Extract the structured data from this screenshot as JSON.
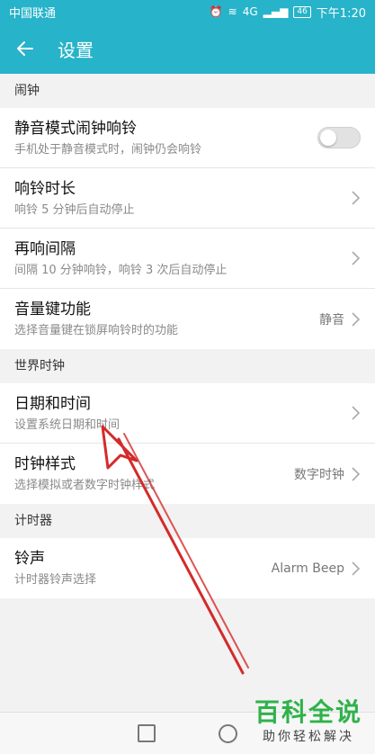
{
  "status_bar": {
    "carrier": "中国联通",
    "network": "4G",
    "battery": "46",
    "time": "下午1:20"
  },
  "app_bar": {
    "title": "设置"
  },
  "sections": {
    "alarm": {
      "header": "闹钟",
      "items": [
        {
          "title": "静音模式闹钟响铃",
          "subtitle": "手机处于静音模式时，闹钟仍会响铃",
          "toggle": false
        },
        {
          "title": "响铃时长",
          "subtitle": "响铃 5 分钟后自动停止"
        },
        {
          "title": "再响间隔",
          "subtitle": "间隔 10 分钟响铃，响铃 3 次后自动停止"
        },
        {
          "title": "音量键功能",
          "subtitle": "选择音量键在锁屏响铃时的功能",
          "value": "静音"
        }
      ]
    },
    "world_clock": {
      "header": "世界时钟",
      "items": [
        {
          "title": "日期和时间",
          "subtitle": "设置系统日期和时间"
        },
        {
          "title": "时钟样式",
          "subtitle": "选择模拟或者数字时钟样式",
          "value": "数字时钟"
        }
      ]
    },
    "timer": {
      "header": "计时器",
      "items": [
        {
          "title": "铃声",
          "subtitle": "计时器铃声选择",
          "value": "Alarm Beep"
        }
      ]
    }
  },
  "watermark": {
    "logo": "百科全说",
    "slogan": "助你轻松解决"
  },
  "colors": {
    "accent": "#27b3c9",
    "annotation": "#d42a2a",
    "watermark": "#2fb24a"
  }
}
